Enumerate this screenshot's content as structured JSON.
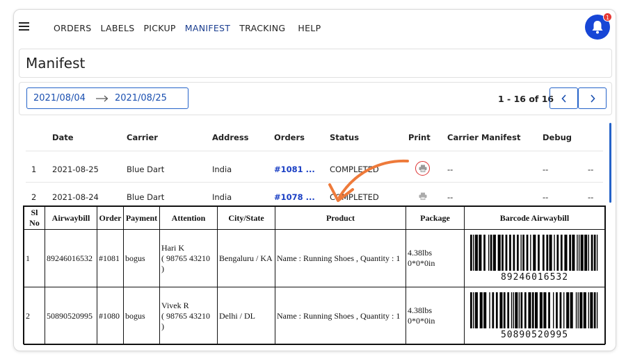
{
  "nav": {
    "links": [
      {
        "label": "ORDERS"
      },
      {
        "label": "LABELS"
      },
      {
        "label": "PICKUP"
      },
      {
        "label": "MANIFEST"
      },
      {
        "label": "TRACKING"
      },
      {
        "label": "HELP"
      }
    ],
    "active": "MANIFEST",
    "notification_count": "1"
  },
  "page": {
    "title": "Manifest"
  },
  "filter": {
    "date_from": "2021/08/04",
    "date_to": "2021/08/25",
    "pager_text": "1 - 16 of 16"
  },
  "manifest_table": {
    "headers": [
      "Date",
      "Carrier",
      "Address",
      "Orders",
      "Status",
      "Print",
      "Carrier Manifest",
      "Debug"
    ],
    "rows": [
      {
        "index": "1",
        "date": "2021-08-25",
        "carrier": "Blue Dart",
        "address": "India",
        "orders": "#1081 ...",
        "status": "COMPLETED",
        "carrier_manifest": "--",
        "debug": "--",
        "extra": "--"
      },
      {
        "index": "2",
        "date": "2021-08-24",
        "carrier": "Blue Dart",
        "address": "India",
        "orders": "#1078 ...",
        "status": "COMPLETED",
        "carrier_manifest": "--",
        "debug": "--",
        "extra": "--"
      }
    ]
  },
  "label_sheet": {
    "headers": [
      "Sl No",
      "Airwaybill",
      "Order",
      "Payment",
      "Attention",
      "City/State",
      "Product",
      "Package",
      "Barcode Airwaybill"
    ],
    "rows": [
      {
        "sl": "1",
        "awb": "89246016532",
        "order": "#1081",
        "payment": "bogus",
        "attention_name": "Hari K",
        "attention_phone": "( 98765 43210",
        "attention_close": ")",
        "city": "Bengaluru / KA",
        "product": "Name : Running Shoes , Quantity : 1",
        "package_weight": "4.38lbs",
        "package_dims": "0*0*0in",
        "barcode_text": "89246016532"
      },
      {
        "sl": "2",
        "awb": "50890520995",
        "order": "#1080",
        "payment": "bogus",
        "attention_name": "Vivek R",
        "attention_phone": "( 98765 43210",
        "attention_close": ")",
        "city": "Delhi / DL",
        "product": "Name : Running Shoes , Quantity : 1",
        "package_weight": "4.38lbs",
        "package_dims": "0*0*0in",
        "barcode_text": "50890520995"
      }
    ]
  },
  "colors": {
    "accent": "#1746d6",
    "link": "#1a3fc4",
    "annotation": "#ee7a3a",
    "highlight_ring": "#dd3333"
  }
}
